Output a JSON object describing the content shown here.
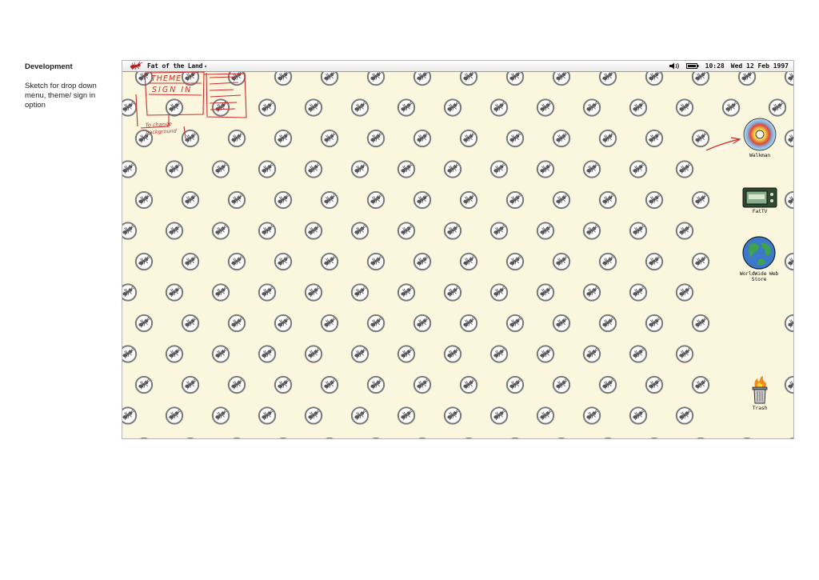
{
  "document": {
    "title": "Development",
    "caption": "Sketch for drop down menu, theme/ sign in option"
  },
  "menubar": {
    "app_name": "Fat of the Land",
    "caret": "▾",
    "time": "10:28",
    "date": "Wed 12 Feb 1997"
  },
  "sketch": {
    "menu_items": [
      "THEME",
      "SIGN IN"
    ],
    "note": "To change background"
  },
  "desktop_icons": {
    "walkman": "Walkman",
    "fattv": "FatTV",
    "store": "WorldWide Web Store",
    "trash": "Trash"
  },
  "colors": {
    "wallpaper": "#fbf7df",
    "ant_badge": "#6e6e6e",
    "sketch_ink": "#cc2a2a"
  }
}
